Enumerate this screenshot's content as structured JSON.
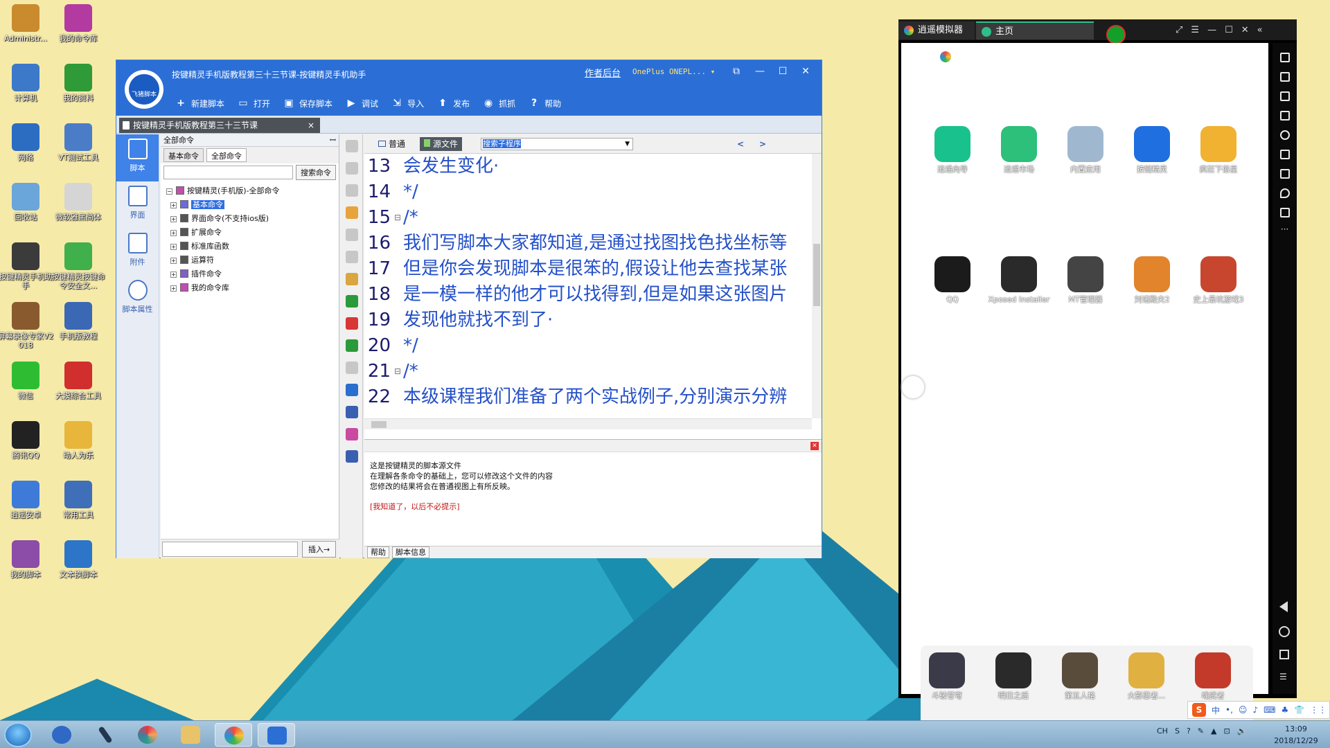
{
  "desktop": {
    "icons": [
      {
        "label": "Administr...",
        "color": "#c98b2d"
      },
      {
        "label": "我的命令库",
        "color": "#b33aa0"
      },
      {
        "label": "计算机",
        "color": "#3d79c9"
      },
      {
        "label": "我的资料",
        "color": "#2f9a38"
      },
      {
        "label": "网络",
        "color": "#2c6dc2"
      },
      {
        "label": "VT测试工具",
        "color": "#4b7cc7"
      },
      {
        "label": "回收站",
        "color": "#6aa6d9"
      },
      {
        "label": "微软雅黑简体",
        "color": "#d5d5d5"
      },
      {
        "label": "按键精灵手机助手",
        "color": "#3b3b3b"
      },
      {
        "label": "按键精灵按键命令安全文...",
        "color": "#3fb04b"
      },
      {
        "label": "屏幕录像专家V2018",
        "color": "#8a5a2f"
      },
      {
        "label": "手机版教程",
        "color": "#3a68b5"
      },
      {
        "label": "微信",
        "color": "#2ebd32"
      },
      {
        "label": "大漠综合工具",
        "color": "#d12e2e"
      },
      {
        "label": "腾讯QQ",
        "color": "#222222"
      },
      {
        "label": "动人为乐",
        "color": "#e8b63b"
      },
      {
        "label": "逍遥安卓",
        "color": "#3e7bd8"
      },
      {
        "label": "常用工具",
        "color": "#3e6fb8"
      },
      {
        "label": "我的脚本",
        "color": "#8b4da8"
      },
      {
        "label": "文本换脚本",
        "color": "#2c75c9"
      }
    ]
  },
  "main_window": {
    "title": "按键精灵手机版教程第三十三节课-按键精灵手机助手",
    "logo_text": "飞猪脚本",
    "author_link": "作者后台",
    "device": "OnePlus  ONEPL...",
    "controls": {
      "restore": "⧉",
      "minimize": "—",
      "maximize": "☐",
      "close": "✕"
    },
    "toolbar": [
      {
        "label": "新建脚本",
        "icon": "+"
      },
      {
        "label": "打开",
        "icon": "▭"
      },
      {
        "label": "保存脚本",
        "icon": "▣"
      },
      {
        "label": "调试",
        "icon": "▶"
      },
      {
        "label": "导入",
        "icon": "⇲"
      },
      {
        "label": "发布",
        "icon": "⬆"
      },
      {
        "label": "抓抓",
        "icon": "◉"
      },
      {
        "label": "帮助",
        "icon": "?"
      }
    ],
    "doc_tab": {
      "label": "按键精灵手机版教程第三十三节课",
      "close": "×"
    },
    "left_nav": [
      {
        "label": "脚本"
      },
      {
        "label": "界面"
      },
      {
        "label": "附件"
      },
      {
        "label": "脚本属性"
      }
    ],
    "command_panel": {
      "header": "全部命令",
      "pin": "ꟷ",
      "tabs": [
        "基本命令",
        "全部命令"
      ],
      "search_button": "搜索命令",
      "tree_root": "按键精灵(手机版)-全部命令",
      "tree_items": [
        "基本命令",
        "界面命令(不支持ios版)",
        "扩展命令",
        "标准库函数",
        "运算符",
        "插件命令",
        "我的命令库"
      ],
      "insert_button": "插入→"
    },
    "editor": {
      "mode_normal": "普通",
      "mode_source": "源文件",
      "combo_value": "搜索子程序",
      "nav_prev": "<",
      "nav_next": ">",
      "lines": [
        {
          "no": "13",
          "fold": "",
          "text": "会发生变化·"
        },
        {
          "no": "14",
          "fold": "",
          "text": "*/"
        },
        {
          "no": "15",
          "fold": "⊟",
          "text": "/*"
        },
        {
          "no": "16",
          "fold": "",
          "text": "我们写脚本大家都知道,是通过找图找色找坐标等"
        },
        {
          "no": "17",
          "fold": "",
          "text": "但是你会发现脚本是很笨的,假设让他去查找某张"
        },
        {
          "no": "18",
          "fold": "",
          "text": "是一模一样的他才可以找得到,但是如果这张图片"
        },
        {
          "no": "19",
          "fold": "",
          "text": "发现他就找不到了·"
        },
        {
          "no": "20",
          "fold": "",
          "text": "*/"
        },
        {
          "no": "21",
          "fold": "⊟",
          "text": "/*"
        },
        {
          "no": "22",
          "fold": "",
          "text": "本级课程我们准备了两个实战例子,分别演示分辨"
        }
      ]
    },
    "help": {
      "lines": [
        "这是按键精灵的脚本源文件",
        "在理解各条命令的基础上，您可以修改这个文件的内容",
        "您修改的结果将会在普通视图上有所反映。"
      ],
      "dismiss": "[我知道了，以后不必提示]",
      "tabs": [
        "帮助",
        "脚本信息"
      ]
    }
  },
  "emulator": {
    "tab1": "逍遥模拟器",
    "tab2": "主页",
    "apps_row1": [
      {
        "label": "逍遥向导",
        "color": "#19c28c"
      },
      {
        "label": "逍遥市场",
        "color": "#2cc07a"
      },
      {
        "label": "内置应用",
        "color": "#9fb8cf"
      },
      {
        "label": "按键精灵",
        "color": "#1f6fe0"
      },
      {
        "label": "疯狂下俗星",
        "color": "#f0b230"
      }
    ],
    "apps_row2": [
      {
        "label": "QQ",
        "color": "#1b1b1b"
      },
      {
        "label": "Xposed Installer",
        "color": "#2a2a2a"
      },
      {
        "label": "MT管理器",
        "color": "#444444"
      },
      {
        "label": "刘诸殿夫2",
        "color": "#e2842b"
      },
      {
        "label": "史上最坑游戏3",
        "color": "#c8462e"
      }
    ],
    "dock": [
      {
        "label": "斗破苍穹",
        "color": "#3a3a48"
      },
      {
        "label": "明日之后",
        "color": "#2a2a2a"
      },
      {
        "label": "第五人格",
        "color": "#5a4c3a"
      },
      {
        "label": "火影忍者...",
        "color": "#e0b041"
      },
      {
        "label": "魂武者",
        "color": "#c33a2a"
      }
    ]
  },
  "taskbar": {
    "ime": [
      "S",
      "中",
      "•,",
      "☺",
      "♪",
      "⌨",
      "♣",
      "👕",
      "⋮⋮"
    ],
    "tray": [
      "CH",
      "S",
      "?",
      "✎",
      "▲",
      "⊡",
      "🔊"
    ],
    "time": "13:09",
    "date": "2018/12/29"
  }
}
